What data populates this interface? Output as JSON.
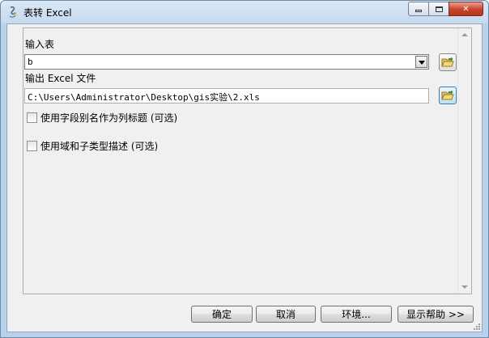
{
  "window": {
    "title": "表转 Excel",
    "caption": {
      "minimize": "▭",
      "maximize": "□",
      "close": "✕"
    }
  },
  "form": {
    "input_table": {
      "label": "输入表",
      "value": "b"
    },
    "output_file": {
      "label": "输出 Excel 文件",
      "value": "C:\\Users\\Administrator\\Desktop\\gis实验\\2.xls"
    },
    "options": [
      {
        "label": "使用字段别名作为列标题 (可选)",
        "checked": false
      },
      {
        "label": "使用域和子类型描述 (可选)",
        "checked": false
      }
    ]
  },
  "footer": {
    "ok": "确定",
    "cancel": "取消",
    "environments": "环境...",
    "show_help": "显示帮助 >>"
  }
}
